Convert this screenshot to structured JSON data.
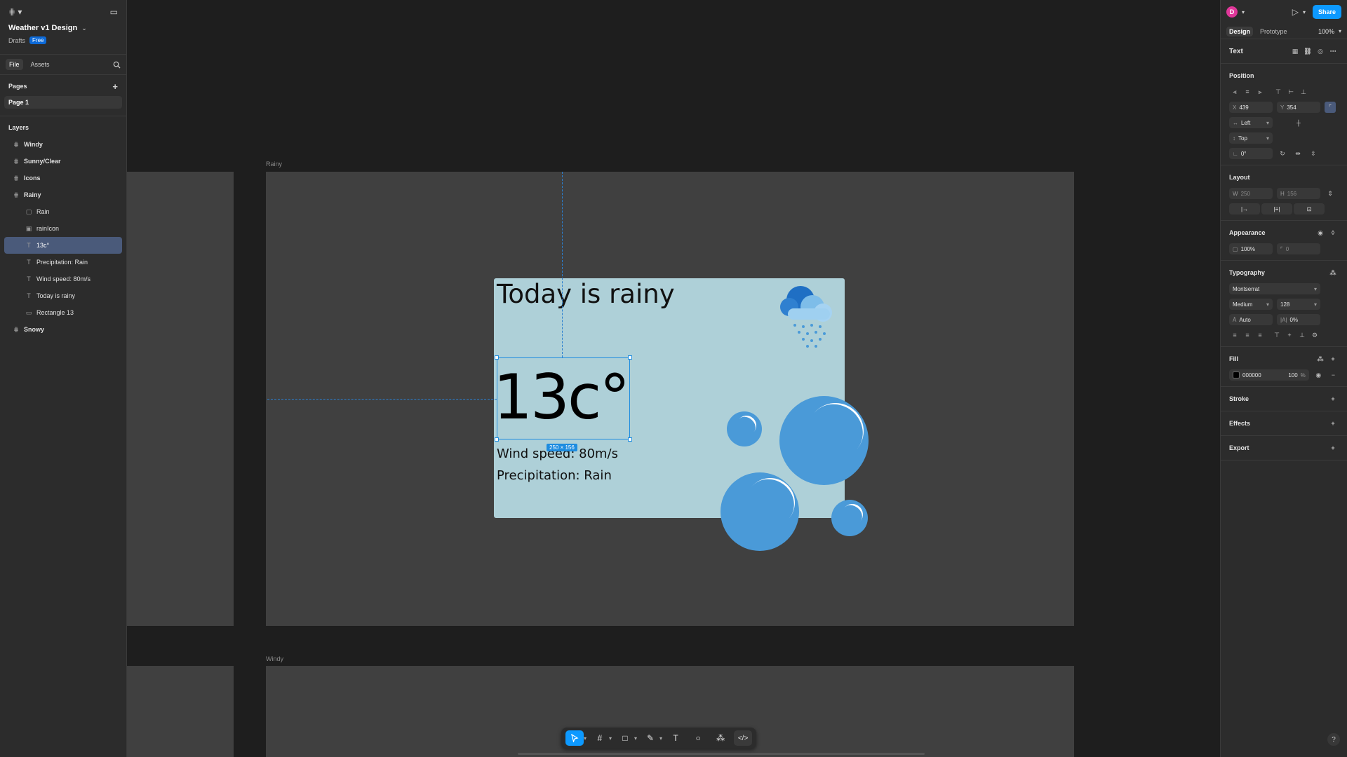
{
  "file": {
    "title": "Weather v1 Design",
    "location": "Drafts",
    "plan_badge": "Free"
  },
  "left_tabs": {
    "file": "File",
    "assets": "Assets"
  },
  "pages": {
    "heading": "Pages",
    "items": [
      "Page 1"
    ]
  },
  "layers": {
    "heading": "Layers",
    "items": [
      {
        "label": "Windy",
        "kind": "frame",
        "level": 0
      },
      {
        "label": "Sunny/Clear",
        "kind": "frame",
        "level": 0
      },
      {
        "label": "Icons",
        "kind": "frame",
        "level": 0
      },
      {
        "label": "Rainy",
        "kind": "frame",
        "level": 0
      },
      {
        "label": "Rain",
        "kind": "group",
        "level": 1
      },
      {
        "label": "rainIcon",
        "kind": "image",
        "level": 1
      },
      {
        "label": "13c°",
        "kind": "text",
        "level": 1,
        "selected": true
      },
      {
        "label": "Precipitation: Rain",
        "kind": "text",
        "level": 1
      },
      {
        "label": "Wind speed: 80m/s",
        "kind": "text",
        "level": 1
      },
      {
        "label": "Today is rainy",
        "kind": "text",
        "level": 1
      },
      {
        "label": "Rectangle 13",
        "kind": "rect",
        "level": 1
      },
      {
        "label": "Snowy",
        "kind": "frame",
        "level": 0
      }
    ]
  },
  "canvas": {
    "frame_labels": {
      "rainy": "Rainy",
      "windy": "Windy"
    },
    "card": {
      "title": "Today is rainy",
      "temperature": "13c°",
      "wind": "Wind speed: 80m/s",
      "precipitation": "Precipitation: Rain",
      "selection_size": "250 × 156"
    },
    "colors": {
      "card_bg": "#aed0d8",
      "bubble": "#4a9ad8",
      "selection": "#1d8ce0"
    }
  },
  "right_panel": {
    "share": "Share",
    "avatar_initial": "D",
    "tabs": {
      "design": "Design",
      "prototype": "Prototype"
    },
    "zoom": "100%",
    "selection_type": "Text",
    "position": {
      "heading": "Position",
      "x_label": "X",
      "x": "439",
      "y_label": "Y",
      "y": "354",
      "h_constraint": "Left",
      "v_constraint": "Top",
      "rotation": "0°"
    },
    "layout": {
      "heading": "Layout",
      "w_label": "W",
      "w": "250",
      "h_label": "H",
      "h": "156"
    },
    "appearance": {
      "heading": "Appearance",
      "opacity": "100%",
      "radius": "0"
    },
    "typography": {
      "heading": "Typography",
      "font": "Montserrat",
      "weight": "Medium",
      "size": "128",
      "line_height": "Auto",
      "letter_spacing": "0%"
    },
    "fill": {
      "heading": "Fill",
      "hex": "000000",
      "opacity": "100",
      "pct": "%"
    },
    "stroke": "Stroke",
    "effects": "Effects",
    "export": "Export"
  }
}
